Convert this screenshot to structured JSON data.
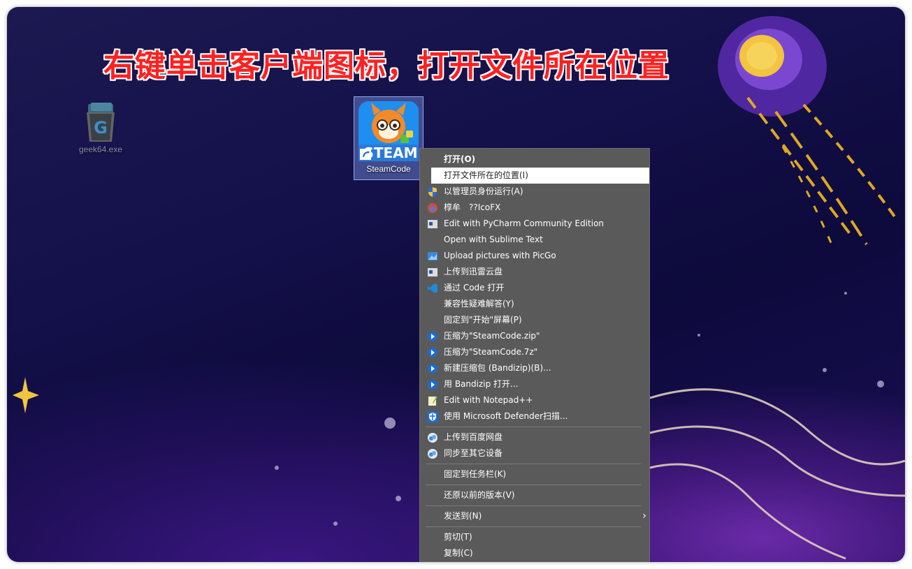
{
  "banner": {
    "text": "右键单击客户端图标，打开文件所在位置"
  },
  "desktop": {
    "icons": [
      {
        "label": "geek64.exe",
        "icon": "recycle-bin-style-app-icon"
      },
      {
        "label": "SteamCode",
        "icon": "steam-fox-app-icon",
        "badge": "STEAM"
      }
    ]
  },
  "context_menu": {
    "items": [
      {
        "label": "打开(O)"
      },
      {
        "label": "打开文件所在的位置(I)"
      },
      {
        "label": "以管理员身份运行(A)",
        "icon": "shield-icon"
      },
      {
        "label": "椁牟　??IcoFX",
        "icon": "icofx-icon"
      },
      {
        "label": "Edit with PyCharm Community Edition",
        "icon": "pycharm-icon"
      },
      {
        "label": "Open with Sublime Text"
      },
      {
        "label": "Upload pictures with PicGo",
        "icon": "picgo-icon"
      },
      {
        "label": "上传到迅雷云盘",
        "icon": "xunlei-icon"
      },
      {
        "label": "通过 Code 打开",
        "icon": "vscode-icon"
      },
      {
        "label": "兼容性疑难解答(Y)"
      },
      {
        "label": "固定到\"开始\"屏幕(P)"
      },
      {
        "label": "压缩为\"SteamCode.zip\"",
        "icon": "bandizip-icon"
      },
      {
        "label": "压缩为\"SteamCode.7z\"",
        "icon": "bandizip-icon"
      },
      {
        "label": "新建压缩包 (Bandizip)(B)...",
        "icon": "bandizip-icon"
      },
      {
        "label": "用 Bandizip 打开...",
        "icon": "bandizip-icon"
      },
      {
        "label": "Edit with Notepad++",
        "icon": "notepadpp-icon"
      },
      {
        "label": "使用 Microsoft Defender扫描...",
        "icon": "defender-icon"
      },
      {
        "label": "上传到百度网盘",
        "icon": "baidu-netdisk-icon"
      },
      {
        "label": "同步至其它设备",
        "icon": "baidu-netdisk-icon"
      },
      {
        "label": "固定到任务栏(K)"
      },
      {
        "label": "还原以前的版本(V)"
      },
      {
        "label": "发送到(N)"
      },
      {
        "label": "剪切(T)"
      },
      {
        "label": "复制(C)"
      }
    ],
    "highlighted": "打开文件所在的位置(I)"
  },
  "colors": {
    "menu_bg": "#5a5a5a",
    "banner_text": "#ff2020",
    "highlight_bg": "#ffffff"
  }
}
